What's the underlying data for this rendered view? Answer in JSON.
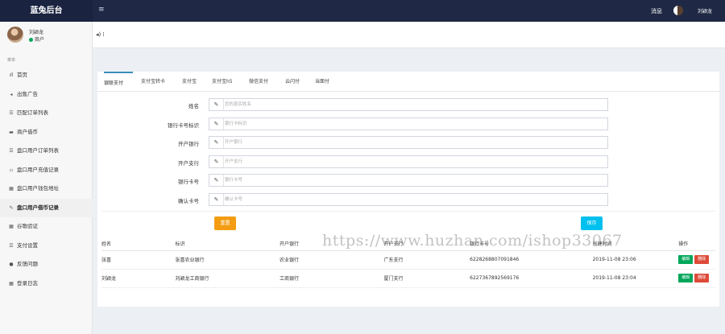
{
  "header": {
    "brand": "蓝兔后台",
    "menu_toggle": "≡",
    "messages_link": "消息",
    "user_name": "刘颖龙"
  },
  "sidebar": {
    "user": {
      "name": "刘颖龙",
      "status": "商户"
    },
    "section_title": "菜单",
    "items": [
      {
        "icon": "chart-icon",
        "glyph": "ıll",
        "label": "首页"
      },
      {
        "icon": "bullhorn-icon",
        "glyph": "◂",
        "label": "出售广告"
      },
      {
        "icon": "list-icon",
        "glyph": "☰",
        "label": "匹配订单列表"
      },
      {
        "icon": "card-icon",
        "glyph": "▬",
        "label": "商户借币"
      },
      {
        "icon": "list-icon",
        "glyph": "☰",
        "label": "盘口用户订单列表"
      },
      {
        "icon": "lock-icon",
        "glyph": "▫",
        "label": "盘口用户充值记录"
      },
      {
        "icon": "grid-icon",
        "glyph": "▦",
        "label": "盘口用户钱包地址"
      },
      {
        "icon": "edit-icon",
        "glyph": "✎",
        "label": "盘口用户借币记录"
      },
      {
        "icon": "grid-icon",
        "glyph": "▦",
        "label": "谷歌验证"
      },
      {
        "icon": "list-icon",
        "glyph": "☰",
        "label": "支付设置"
      },
      {
        "icon": "comment-icon",
        "glyph": "●",
        "label": "反馈问题"
      },
      {
        "icon": "grid-icon",
        "glyph": "▦",
        "label": "登录日志"
      }
    ],
    "active_index": 7
  },
  "subheader": {
    "volume_icon": "◂)  ⁞"
  },
  "tabs": [
    "银联支付",
    "支付宝转卡",
    "支付宝",
    "支付宝h5",
    "微信支付",
    "云闪付",
    "当面付"
  ],
  "tab_active_index": 0,
  "form": {
    "fields": [
      {
        "label": "姓名",
        "placeholder": "您的真实姓名",
        "value": ""
      },
      {
        "label": "银行卡号标识",
        "placeholder": "银行卡标识",
        "value": ""
      },
      {
        "label": "开户银行",
        "placeholder": "开户银行",
        "value": ""
      },
      {
        "label": "开户支行",
        "placeholder": "开户支行",
        "value": ""
      },
      {
        "label": "银行卡号",
        "placeholder": "银行卡号",
        "value": ""
      },
      {
        "label": "确认卡号",
        "placeholder": "确认卡号",
        "value": ""
      }
    ],
    "reset_label": "重置",
    "save_label": "保存"
  },
  "table": {
    "columns": [
      "姓名",
      "标识",
      "开户银行",
      "开户支行",
      "银行卡号",
      "创建时间",
      "操作"
    ],
    "rows": [
      {
        "name": "张喜",
        "tag": "张喜农业银行",
        "bank": "农业银行",
        "branch": "广东支行",
        "card": "6228268807091846",
        "created": "2019-11-08 23:06"
      },
      {
        "name": "刘颖龙",
        "tag": "刘颖龙工商银行",
        "bank": "工商银行",
        "branch": "厦门支行",
        "card": "6227367892569176",
        "created": "2019-11-08 23:04"
      }
    ],
    "edit_label": "编辑",
    "delete_label": "删除"
  },
  "watermark": "https://www.huzhan.com/ishop33067",
  "colors": {
    "topbar": "#1f2945",
    "tab_accent": "#3c8dbc",
    "reset": "#f39c12",
    "save": "#00c0ef",
    "edit": "#00a65a",
    "delete": "#dd4b39"
  }
}
